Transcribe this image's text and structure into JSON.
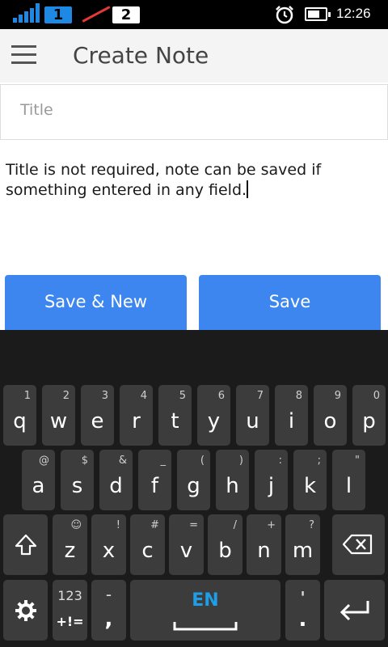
{
  "status_bar": {
    "sim1": "1",
    "sim2": "2",
    "time": "12:26",
    "icons": [
      "signal-icon",
      "sim-1-badge",
      "no-signal-icon",
      "sim-2-badge",
      "alarm-clock-icon",
      "battery-icon"
    ]
  },
  "app_bar": {
    "title": "Create Note",
    "menu_icon": "hamburger-menu-icon"
  },
  "form": {
    "title_placeholder": "Title",
    "title_value": "",
    "note_value": "Title is not required, note can be saved if something entered in any field."
  },
  "buttons": {
    "save_new": "Save & New",
    "save": "Save"
  },
  "keyboard": {
    "row1": [
      {
        "k": "q",
        "h": "1"
      },
      {
        "k": "w",
        "h": "2"
      },
      {
        "k": "e",
        "h": "3"
      },
      {
        "k": "r",
        "h": "4"
      },
      {
        "k": "t",
        "h": "5"
      },
      {
        "k": "y",
        "h": "6"
      },
      {
        "k": "u",
        "h": "7"
      },
      {
        "k": "i",
        "h": "8"
      },
      {
        "k": "o",
        "h": "9"
      },
      {
        "k": "p",
        "h": "0"
      }
    ],
    "row2": [
      {
        "k": "a",
        "h": "@"
      },
      {
        "k": "s",
        "h": "$"
      },
      {
        "k": "d",
        "h": "&"
      },
      {
        "k": "f",
        "h": "_"
      },
      {
        "k": "g",
        "h": "("
      },
      {
        "k": "h",
        "h": ")"
      },
      {
        "k": "j",
        "h": ":"
      },
      {
        "k": "k",
        "h": ";"
      },
      {
        "k": "l",
        "h": "\""
      }
    ],
    "row3": [
      {
        "k": "z",
        "h": "☺"
      },
      {
        "k": "x",
        "h": "!"
      },
      {
        "k": "c",
        "h": "#"
      },
      {
        "k": "v",
        "h": "="
      },
      {
        "k": "b",
        "h": "/"
      },
      {
        "k": "n",
        "h": "+"
      },
      {
        "k": "m",
        "h": "?"
      }
    ],
    "numbers_label": "123",
    "symbols_label": "+!=",
    "dash_label": "-",
    "comma_label": ",",
    "language_label": "EN",
    "apostrophe_label": "'",
    "period_label": ".",
    "accent_color": "#1e9ee6"
  }
}
